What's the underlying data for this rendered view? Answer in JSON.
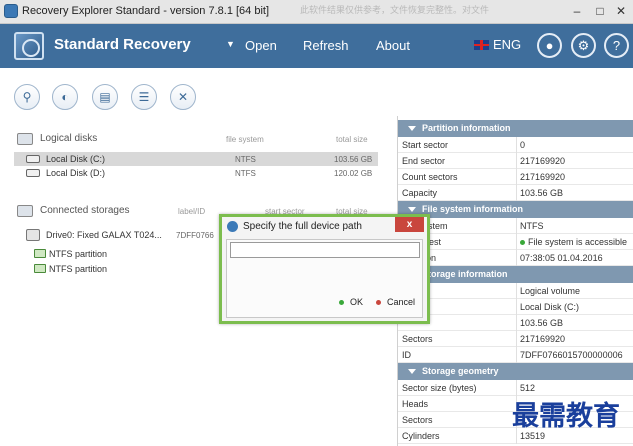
{
  "window": {
    "title": "Recovery Explorer Standard - version 7.8.1 [64 bit]",
    "watermark_text": "此软件结果仅供参考，文件恢复完整性。对文件"
  },
  "header": {
    "brand": "Standard Recovery",
    "menu_open": "Open",
    "menu_refresh": "Refresh",
    "menu_about": "About",
    "language": "ENG"
  },
  "toolbar": {
    "icons": [
      "search-icon",
      "scan-icon",
      "open-image-icon",
      "list-icon",
      "close-icon"
    ]
  },
  "logical_disks": {
    "title": "Logical disks",
    "col_fs": "file system",
    "col_size": "total size",
    "items": [
      {
        "name": "Local Disk (C:)",
        "fs": "NTFS",
        "size": "103.56 GB"
      },
      {
        "name": "Local Disk (D:)",
        "fs": "NTFS",
        "size": "120.02 GB"
      }
    ]
  },
  "storages": {
    "title": "Connected storages",
    "col_label": "label/ID",
    "col_start": "start sector",
    "col_size": "total size",
    "drive": {
      "name": "Drive0: Fixed GALAX T024...",
      "id": "7DFF0766"
    },
    "partitions": [
      "NTFS partition",
      "NTFS partition"
    ]
  },
  "partition_info": {
    "title": "Partition information",
    "rows": [
      {
        "label": "Start sector",
        "value": "0"
      },
      {
        "label": "End sector",
        "value": "217169920"
      },
      {
        "label": "Count sectors",
        "value": "217169920"
      },
      {
        "label": "Capacity",
        "value": "103.56 GB"
      }
    ]
  },
  "fs_info": {
    "title": "File system information",
    "rows": [
      {
        "label": "File system",
        "value": "NTFS"
      },
      {
        "label": "Basic test",
        "value": "File system is accessible"
      },
      {
        "label": "Creation",
        "value": "07:38:05 01.04.2016"
      }
    ]
  },
  "storage_info": {
    "title": "Storage information",
    "rows": [
      {
        "label": "",
        "value": "Logical volume"
      },
      {
        "label": "",
        "value": "Local Disk (C:)"
      },
      {
        "label": "",
        "value": "103.56 GB"
      },
      {
        "label": "Sectors",
        "value": "217169920"
      },
      {
        "label": "ID",
        "value": "7DFF0766015700000006"
      }
    ]
  },
  "geometry": {
    "title": "Storage geometry",
    "rows": [
      {
        "label": "Sector size (bytes)",
        "value": "512"
      },
      {
        "label": "Heads",
        "value": ""
      },
      {
        "label": "Sectors",
        "value": ""
      },
      {
        "label": "Cylinders",
        "value": "13519"
      }
    ]
  },
  "dialog": {
    "title": "Specify the full device path",
    "close": "x",
    "input_value": "",
    "ok": "OK",
    "cancel": "Cancel",
    "ok_color": "#3aa83a",
    "cancel_color": "#c9463d"
  },
  "corner_watermark": "最需教育"
}
